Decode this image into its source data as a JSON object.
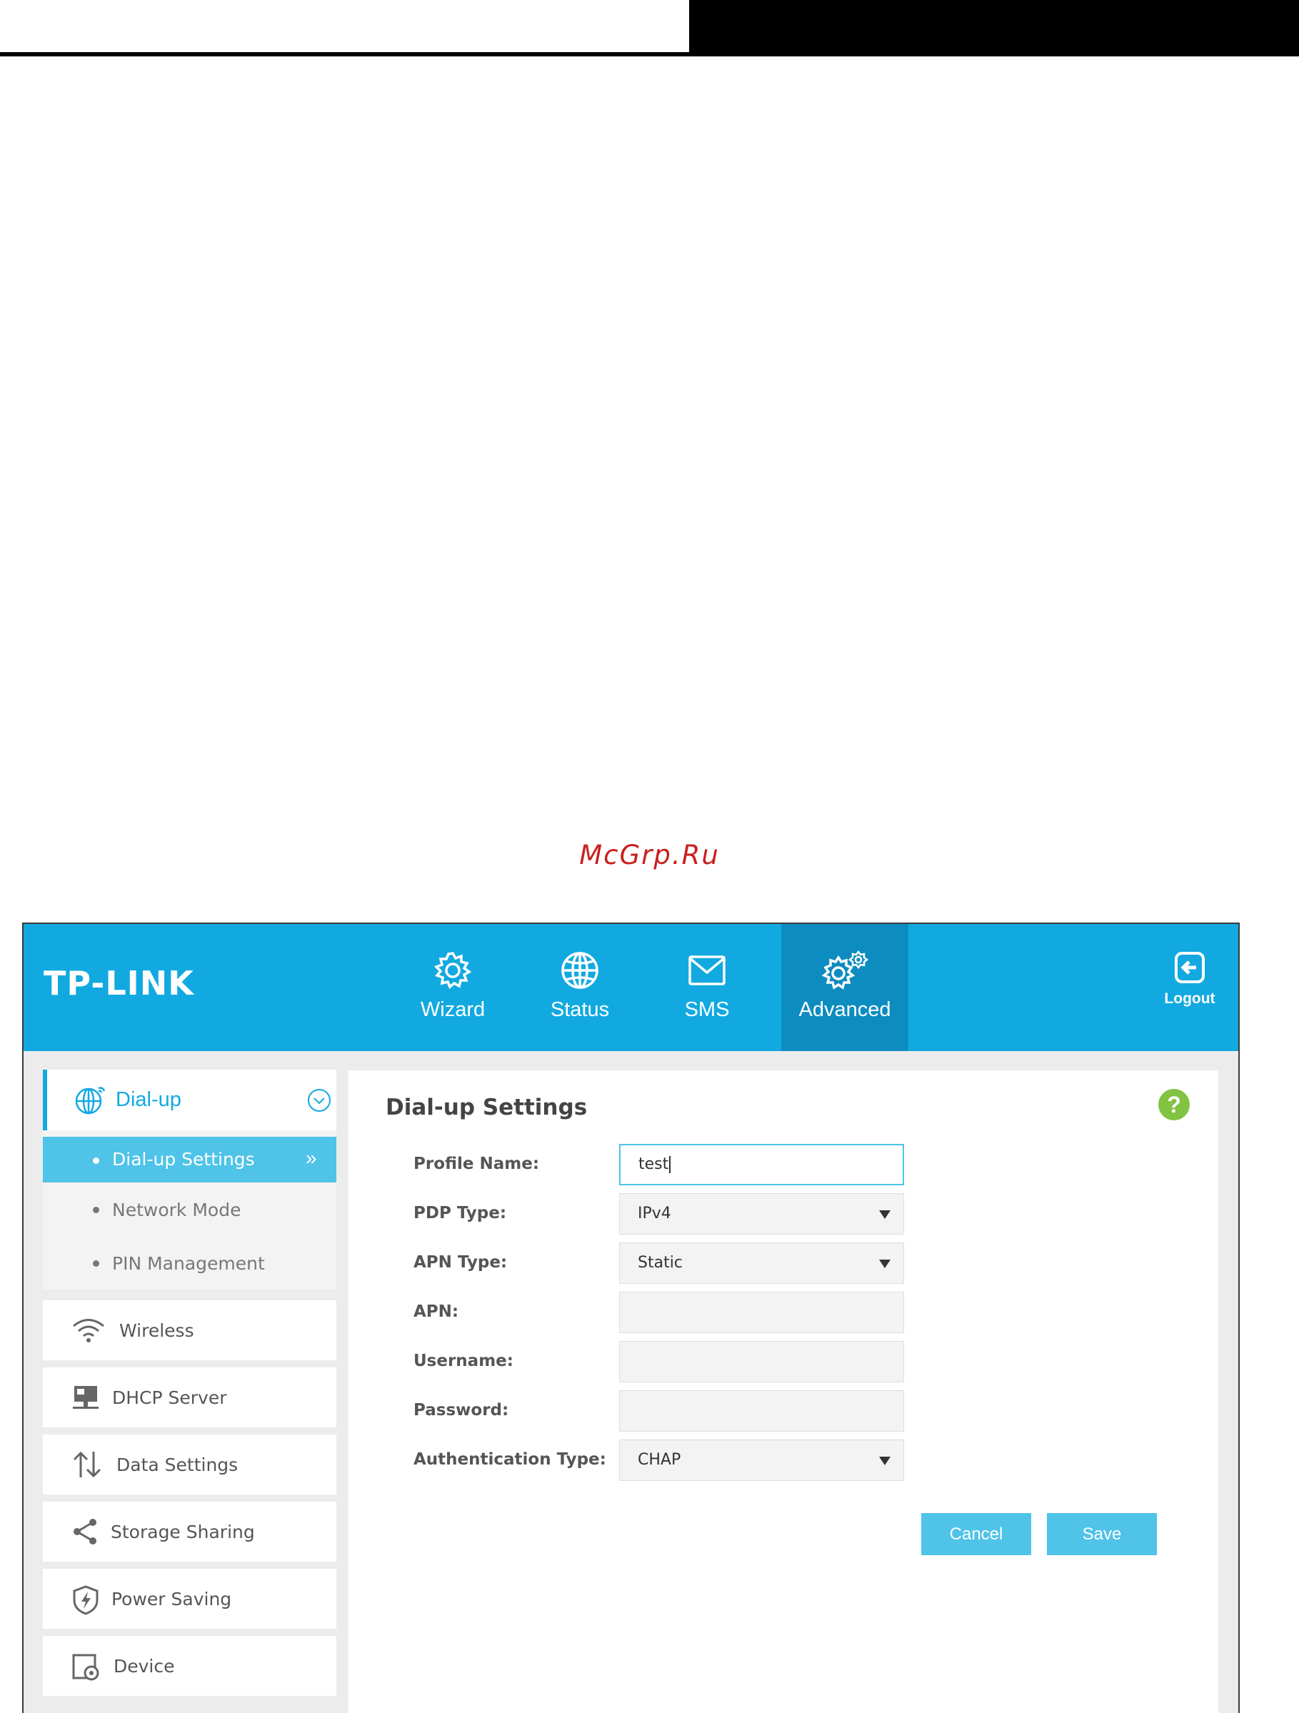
{
  "watermark": "McGrp.Ru",
  "brand": {
    "logo": "TP-LINK",
    "accent": "#12a9e0",
    "active_nav": "#0d8cc0",
    "light_accent": "#4fc3e8",
    "help": "#82c341"
  },
  "nav": {
    "items": [
      {
        "label": "Wizard",
        "icon": "gear-icon"
      },
      {
        "label": "Status",
        "icon": "globe-icon"
      },
      {
        "label": "SMS",
        "icon": "envelope-icon"
      },
      {
        "label": "Advanced",
        "icon": "gears-icon",
        "active": true
      }
    ],
    "logout": "Logout"
  },
  "sidebar": {
    "section": {
      "label": "Dial-up",
      "icon": "globe-icon",
      "subitems": [
        {
          "label": "Dial-up Settings",
          "active": true
        },
        {
          "label": "Network Mode"
        },
        {
          "label": "PIN Management"
        }
      ]
    },
    "items": [
      {
        "label": "Wireless",
        "icon": "wifi-icon"
      },
      {
        "label": "DHCP Server",
        "icon": "dhcp-icon"
      },
      {
        "label": "Data Settings",
        "icon": "updown-arrows-icon"
      },
      {
        "label": "Storage Sharing",
        "icon": "share-icon"
      },
      {
        "label": "Power Saving",
        "icon": "shield-bolt-icon"
      },
      {
        "label": "Device",
        "icon": "device-gear-icon"
      }
    ]
  },
  "main": {
    "title": "Dial-up Settings",
    "help": "?",
    "fields": [
      {
        "label": "Profile Name:",
        "value": "test"
      },
      {
        "label": "PDP Type:",
        "value": "IPv4"
      },
      {
        "label": "APN Type:",
        "value": "Static"
      },
      {
        "label": "APN:",
        "value": ""
      },
      {
        "label": "Username:",
        "value": ""
      },
      {
        "label": "Password:",
        "value": ""
      },
      {
        "label": "Authentication Type:",
        "value": "CHAP"
      }
    ],
    "cancel": "Cancel",
    "save": "Save"
  }
}
